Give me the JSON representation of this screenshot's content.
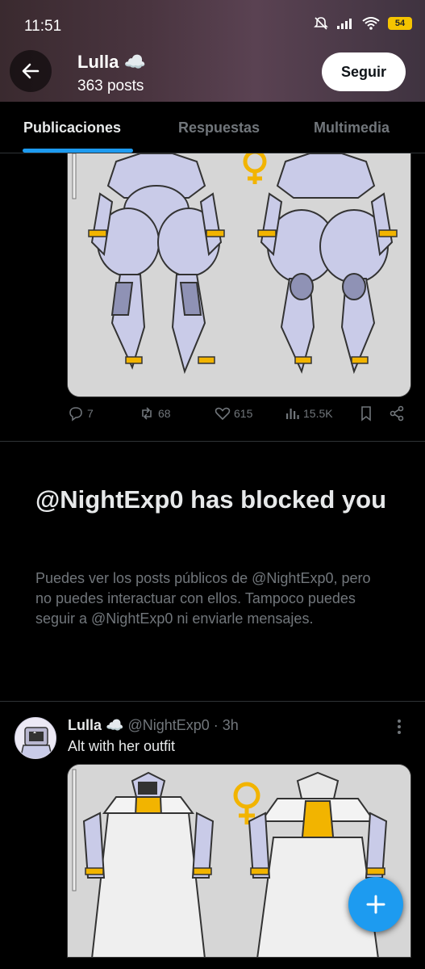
{
  "status_bar": {
    "time": "11:51",
    "battery": "54"
  },
  "header": {
    "title": "Lulla ☁️",
    "posts_count": "363 posts",
    "follow_label": "Seguir"
  },
  "tabs": [
    {
      "label": "Publicaciones",
      "active": true
    },
    {
      "label": "Respuestas",
      "active": false
    },
    {
      "label": "Multimedia",
      "active": false
    }
  ],
  "post1_actions": {
    "replies": "7",
    "reposts": "68",
    "likes": "615",
    "views": "15.5K"
  },
  "blocked": {
    "title": "@NightExp0 has blocked you",
    "description": "Puedes ver los posts públicos de @NightExp0, pero no puedes interactuar con ellos. Tampoco puedes seguir a @NightExp0 ni enviarle mensajes."
  },
  "post2": {
    "name": "Lulla ☁️",
    "handle": "@NightExp0",
    "time": "· 3h",
    "text": "Alt with her outfit"
  },
  "colors": {
    "accent": "#1d9bf0",
    "background": "#000000",
    "muted": "#71767b",
    "female_symbol": "#f2b400"
  },
  "icons": [
    "back-arrow-icon",
    "reply-icon",
    "repost-icon",
    "like-icon",
    "views-icon",
    "bookmark-icon",
    "share-icon",
    "more-icon",
    "compose-plus-icon",
    "female-symbol-icon"
  ]
}
